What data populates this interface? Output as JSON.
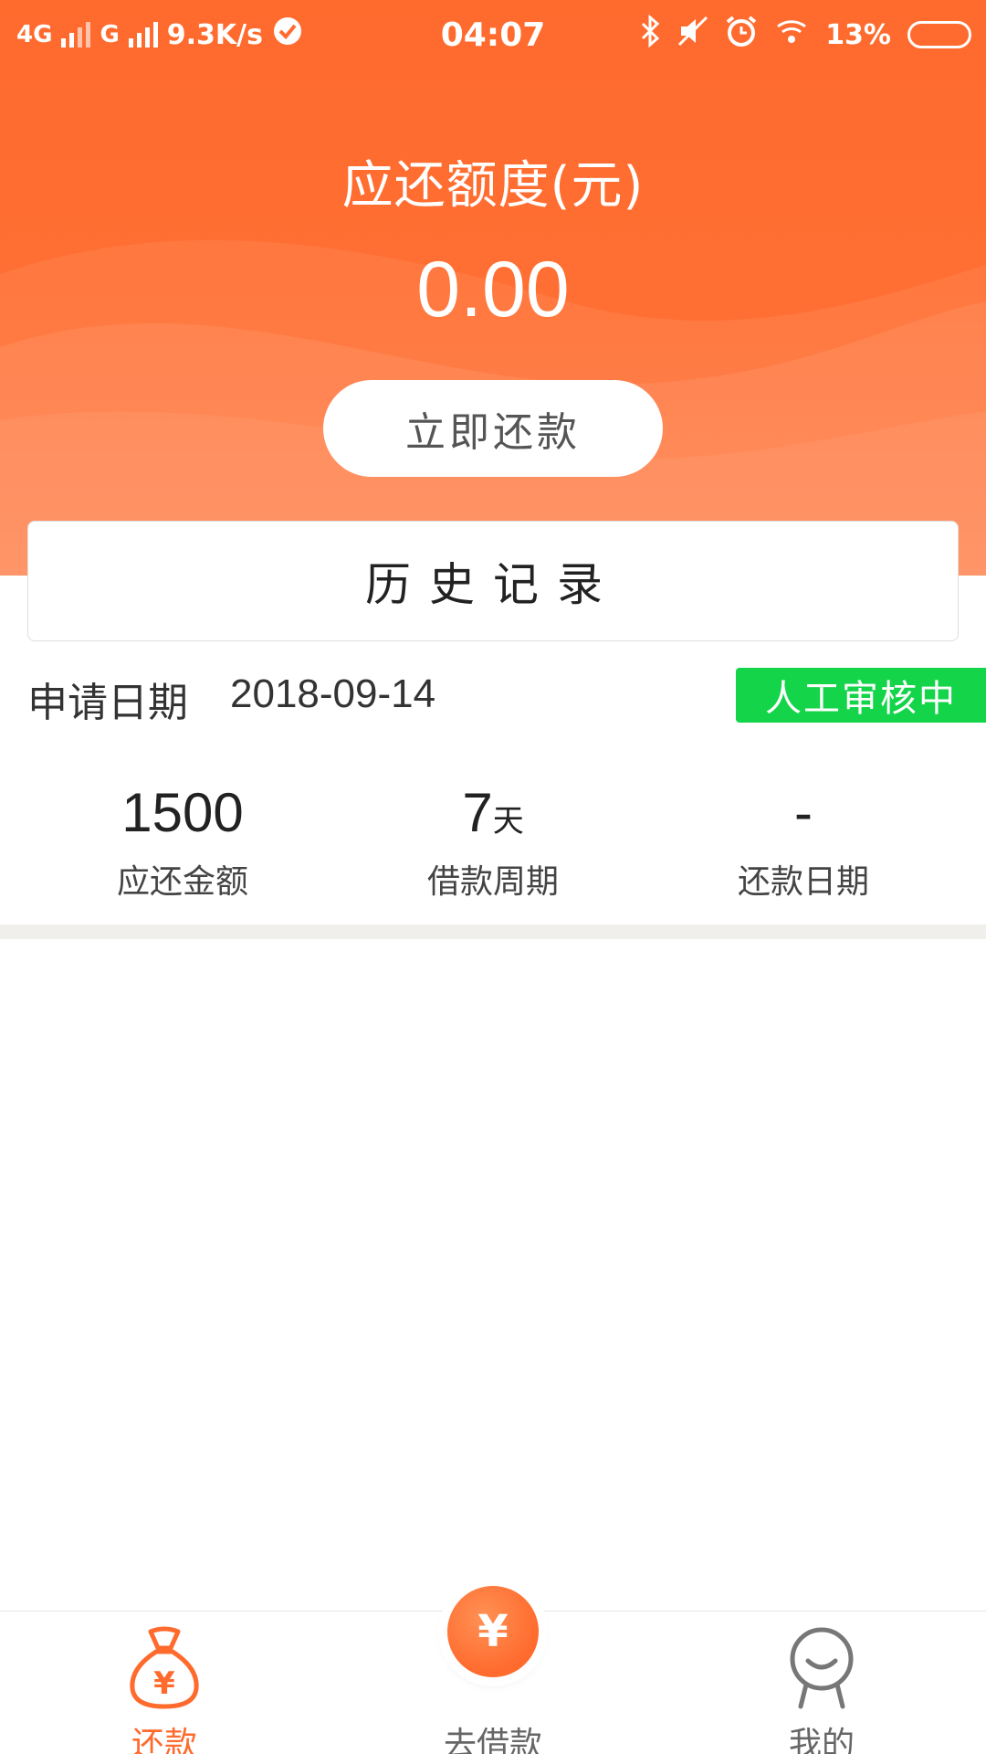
{
  "status_bar": {
    "network1": "4G",
    "network2": "G",
    "speed": "9.3K/s",
    "time": "04:07",
    "battery": "13%"
  },
  "header": {
    "amount_title": "应还额度(元)",
    "amount_value": "0.00",
    "repay_button": "立即还款"
  },
  "history": {
    "title": "历史记录"
  },
  "record": {
    "apply_label": "申请日期",
    "apply_date": "2018-09-14",
    "status": "人工审核中",
    "stats": [
      {
        "value": "1500",
        "unit": "",
        "label": "应还金额"
      },
      {
        "value": "7",
        "unit": "天",
        "label": "借款周期"
      },
      {
        "value": "-",
        "unit": "",
        "label": "还款日期"
      }
    ]
  },
  "bottom_nav": {
    "items": [
      {
        "label": "还款",
        "icon": "money-bag-icon",
        "active": true
      },
      {
        "label": "去借款",
        "icon": "yen-circle-icon",
        "active": false
      },
      {
        "label": "我的",
        "icon": "user-face-icon",
        "active": false
      }
    ],
    "fab_symbol": "¥",
    "bag_symbol": "¥"
  },
  "colors": {
    "brand": "#ff6a2d",
    "status_green": "#14d44a"
  }
}
